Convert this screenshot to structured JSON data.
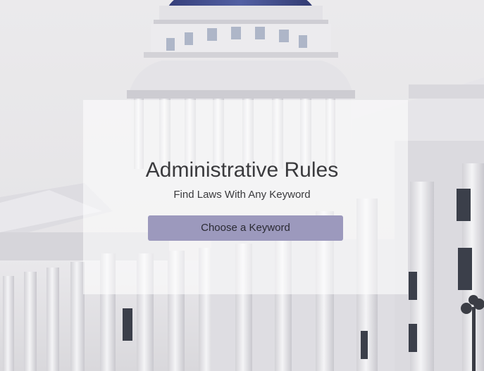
{
  "hero": {
    "title": "Administrative Rules",
    "subtitle": "Find Laws With Any Keyword",
    "button_label": "Choose a Keyword"
  },
  "colors": {
    "dome": "#3f4a86",
    "button_bg": "#9c99bd",
    "panel_bg": "#ffffff",
    "text": "#3a3a3d"
  },
  "background": {
    "subject": "capitol-building-photo"
  }
}
